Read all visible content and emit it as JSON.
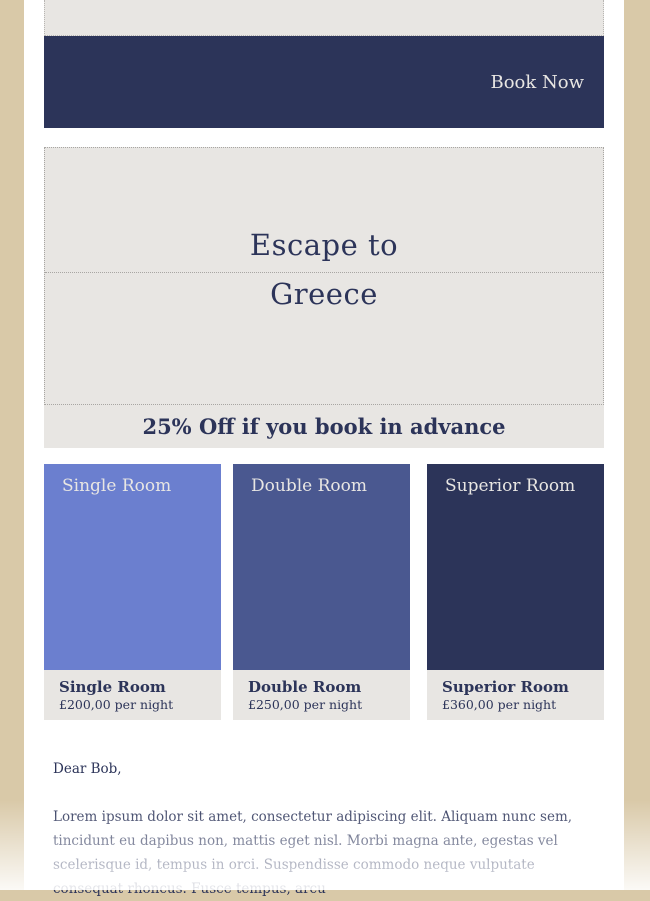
{
  "header": {
    "book_now_label": "Book Now"
  },
  "hero": {
    "title_line1": "Escape to",
    "title_line2": "Greece"
  },
  "offer": {
    "text": "25% Off if you book in advance"
  },
  "rooms": [
    {
      "image_label": "Single Room",
      "name": "Single Room",
      "price": "£200,00 per night",
      "color": "#6b7fcf"
    },
    {
      "image_label": "Double Room",
      "name": "Double Room",
      "price": "£250,00 per night",
      "color": "#4a5890"
    },
    {
      "image_label": "Superior Room",
      "name": "Superior Room",
      "price": "£360,00 per night",
      "color": "#2c3459"
    }
  ],
  "letter": {
    "greeting": "Dear Bob,",
    "body": "Lorem ipsum dolor sit amet, consectetur adipiscing elit. Aliquam nunc sem, tincidunt eu dapibus non, mattis eget nisl. Morbi magna ante, egestas vel scelerisque id, tempus in orci. Suspendisse commodo neque vulputate consequat rhoncus. Fusce tempus, arcu"
  },
  "colors": {
    "brand_navy": "#2c3459",
    "panel_gray": "#e8e6e3",
    "backdrop_beige": "#d9c9a8"
  }
}
